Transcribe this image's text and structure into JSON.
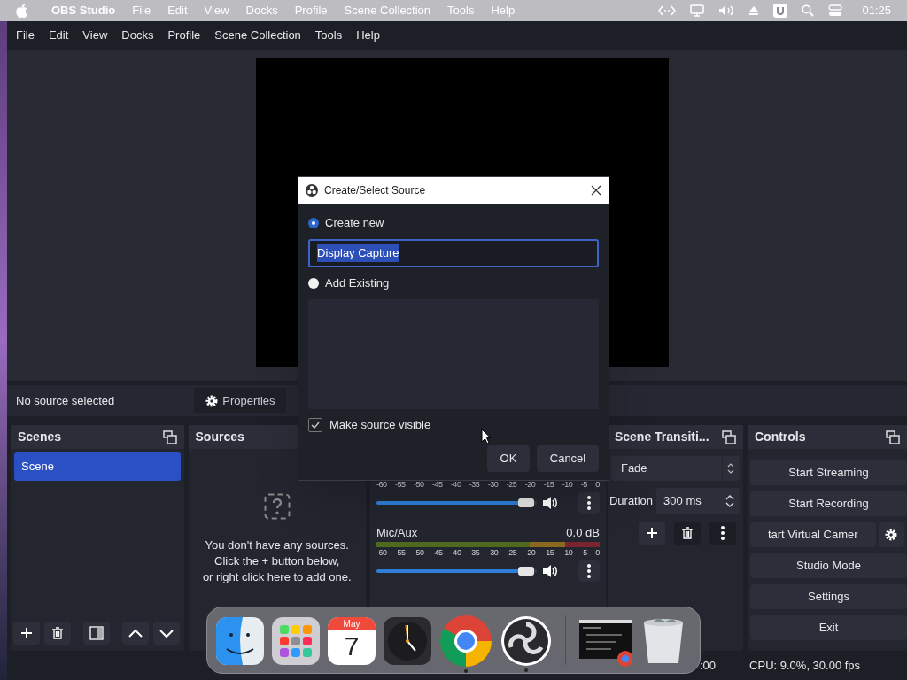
{
  "menubar": {
    "app": "OBS Studio",
    "menus": [
      "File",
      "Edit",
      "View",
      "Docks",
      "Profile",
      "Scene Collection",
      "Tools",
      "Help"
    ],
    "clock": "01:25"
  },
  "obs": {
    "menus": [
      "File",
      "Edit",
      "View",
      "Docks",
      "Profile",
      "Scene Collection",
      "Tools",
      "Help"
    ],
    "context": {
      "label": "No source selected",
      "properties": "Properties"
    },
    "scenes": {
      "title": "Scenes",
      "items": [
        {
          "name": "Scene",
          "selected": true
        }
      ]
    },
    "sources": {
      "title": "Sources",
      "empty": "You don't have any sources.\nClick the + button below,\nor right click here to add one."
    },
    "mixer": {
      "channels": [
        {
          "scale": [
            "-60",
            "-55",
            "-50",
            "-45",
            "-40",
            "-35",
            "-30",
            "-25",
            "-20",
            "-15",
            "-10",
            "-5",
            "0"
          ],
          "level": 0.94
        },
        {
          "name": "Mic/Aux",
          "reading": "0.0 dB",
          "scale": [
            "-60",
            "-55",
            "-50",
            "-45",
            "-40",
            "-35",
            "-30",
            "-25",
            "-20",
            "-15",
            "-10",
            "-5",
            "0"
          ],
          "level": 0.94
        }
      ]
    },
    "transitions": {
      "title": "Scene Transiti...",
      "transition": "Fade",
      "duration_label": "Duration",
      "duration": "300 ms"
    },
    "controls": {
      "title": "Controls",
      "buttons": [
        {
          "label": "Start Streaming",
          "kind": "plain"
        },
        {
          "label": "Start Recording",
          "kind": "plain"
        },
        {
          "label": "tart Virtual Camer",
          "kind": "with-settings"
        },
        {
          "label": "Studio Mode",
          "kind": "plain"
        },
        {
          "label": "Settings",
          "kind": "plain"
        },
        {
          "label": "Exit",
          "kind": "plain"
        }
      ]
    },
    "status_bar": {
      "time": ":00",
      "cpu": "CPU: 9.0%, 30.00 fps"
    }
  },
  "dialog": {
    "title": "Create/Select Source",
    "options": [
      {
        "label": "Create new",
        "selected": true
      },
      {
        "label": "Add Existing",
        "selected": false
      }
    ],
    "name_value": "Display Capture",
    "visible": {
      "label": "Make source visible",
      "checked": true
    },
    "buttons": [
      "OK",
      "Cancel"
    ]
  },
  "dock": {
    "apps": [
      {
        "kind": "finder",
        "running": false
      },
      {
        "kind": "launchpad",
        "running": false
      },
      {
        "kind": "calendar",
        "month": "May",
        "day": "7",
        "running": false
      },
      {
        "kind": "clock",
        "running": false
      },
      {
        "kind": "chrome",
        "running": true
      },
      {
        "kind": "obs",
        "running": true
      },
      {
        "kind": "separator"
      },
      {
        "kind": "window",
        "running": false
      },
      {
        "kind": "trash",
        "running": false
      }
    ]
  }
}
